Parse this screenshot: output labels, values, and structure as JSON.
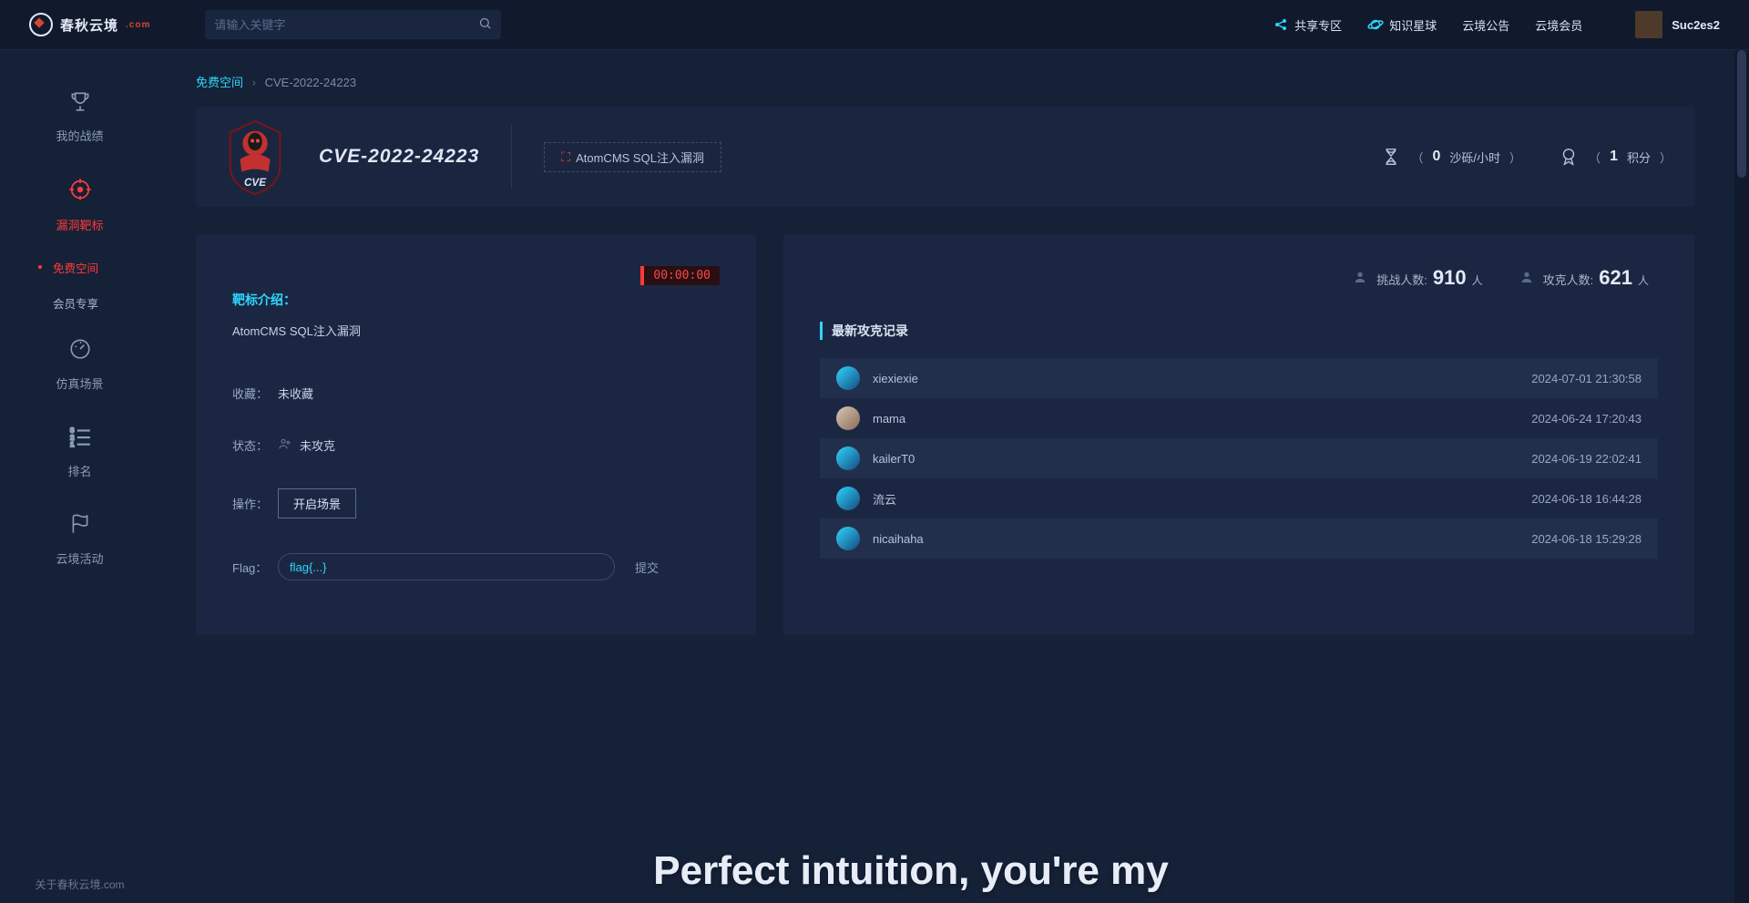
{
  "header": {
    "brand": "春秋云境",
    "brand_suffix": ".com",
    "search_placeholder": "请输入关键字",
    "nav_share": "共享专区",
    "nav_star": "知识星球",
    "nav_notice": "云境公告",
    "nav_member": "云境会员",
    "username": "Suc2es2"
  },
  "sidebar": {
    "items": [
      {
        "label": "我的战绩"
      },
      {
        "label": "漏洞靶标"
      },
      {
        "label": "仿真场景"
      },
      {
        "label": "排名"
      },
      {
        "label": "云境活动"
      }
    ],
    "sub": [
      {
        "label": "免费空间"
      },
      {
        "label": "会员专享"
      }
    ],
    "footer": "关于春秋云境.com"
  },
  "crumb": {
    "root": "免费空间",
    "current": "CVE-2022-24223"
  },
  "banner": {
    "title": "CVE-2022-24223",
    "tag": "AtomCMS SQL注入漏洞",
    "sandbox_value": "0",
    "sandbox_unit": "沙砾/小时",
    "points_value": "1",
    "points_unit": "积分"
  },
  "left": {
    "timer": "00:00:00",
    "intro_label": "靶标介绍：",
    "intro_text": "AtomCMS SQL注入漏洞",
    "kv": {
      "k_fav": "收藏：",
      "v_fav": "未收藏",
      "k_status": "状态：",
      "v_status": "未攻克",
      "k_op": "操作：",
      "btn_open": "开启场景",
      "k_flag": "Flag：",
      "flag_placeholder": "flag{...}",
      "submit": "提交"
    }
  },
  "right": {
    "challenge_label": "挑战人数:",
    "challenge_count": "910",
    "conquer_label": "攻克人数:",
    "conquer_count": "621",
    "unit": "人",
    "section_title": "最新攻克记录",
    "records": [
      {
        "name": "xiexiexie",
        "time": "2024-07-01 21:30:58"
      },
      {
        "name": "mama",
        "time": "2024-06-24 17:20:43"
      },
      {
        "name": "kailerT0",
        "time": "2024-06-19 22:02:41"
      },
      {
        "name": "流云",
        "time": "2024-06-18 16:44:28"
      },
      {
        "name": "nicaihaha",
        "time": "2024-06-18 15:29:28"
      }
    ]
  },
  "hero": "Perfect intuition, you're my"
}
